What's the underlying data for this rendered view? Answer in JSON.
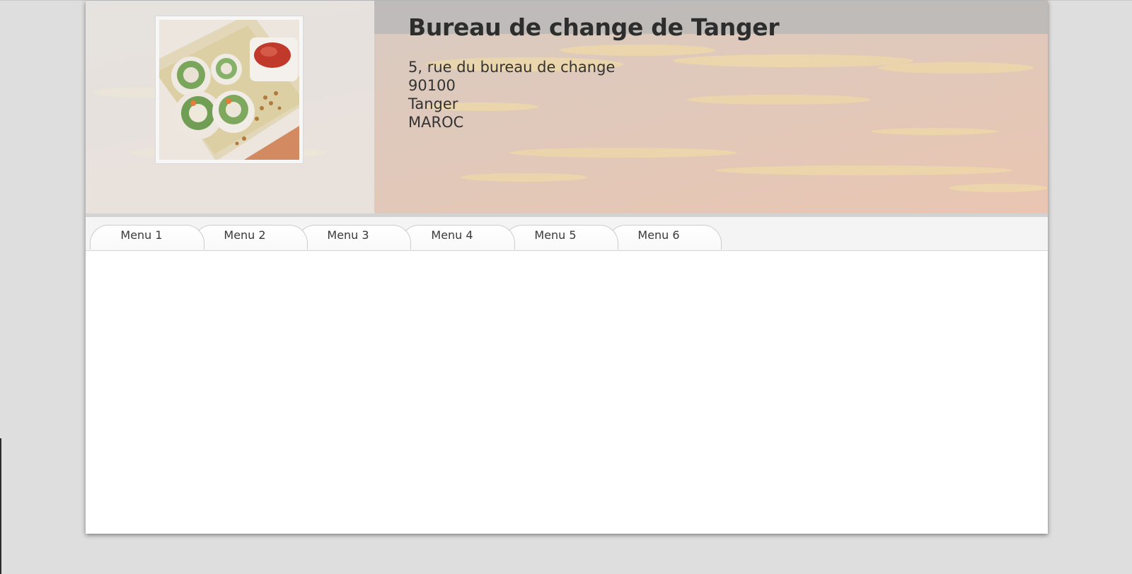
{
  "header": {
    "title": "Bureau de change de Tanger",
    "address": {
      "street": "5, rue du bureau de change",
      "postal_code": "90100",
      "city": "Tanger",
      "country": "MAROC"
    },
    "photo_alt": "Rouleaux de printemps"
  },
  "nav": {
    "tabs": [
      {
        "label": "Menu 1"
      },
      {
        "label": "Menu 2"
      },
      {
        "label": "Menu 3"
      },
      {
        "label": "Menu 4"
      },
      {
        "label": "Menu 5"
      },
      {
        "label": "Menu 6"
      }
    ]
  },
  "colors": {
    "page_background": "#dedede",
    "title_text": "#2d2d2d",
    "tab_border": "#cccccc",
    "content_background": "#ffffff"
  }
}
